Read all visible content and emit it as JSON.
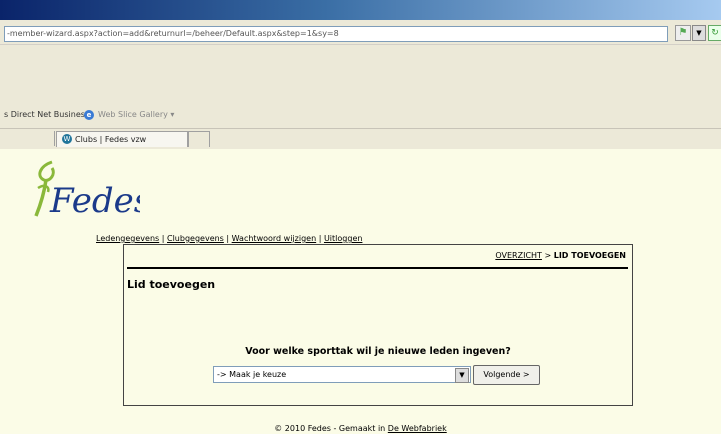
{
  "browser": {
    "address_url": "-member-wizard.aspx?action=add&returnurl=/beheer/Default.aspx&step=1&sy=8",
    "favorites": [
      {
        "label": "s Direct Net Business"
      },
      {
        "label": "Web Slice Gallery ▾"
      }
    ],
    "tabs": [
      {
        "label": "Clubs | Fedes vzw"
      }
    ]
  },
  "page": {
    "logo_text": "Fedes",
    "nav": {
      "ledengegevens": "Ledengegevens",
      "clubgegevens": "Clubgegevens",
      "wachtwoord": "Wachtwoord wijzigen",
      "uitloggen": "Uitloggen",
      "separator": "|"
    },
    "breadcrumb": {
      "overzicht": "OVERZICHT",
      "arrow": ">",
      "current": "LID TOEVOEGEN"
    },
    "title": "Lid toevoegen",
    "question": "Voor welke sporttak wil je nieuwe leden ingeven?",
    "select": {
      "selected": "-> Maak je keuze"
    },
    "next_button": "Volgende >",
    "footer": {
      "text": "© 2010 Fedes - Gemaakt in ",
      "link": "De Webfabriek"
    }
  },
  "colors": {
    "page_background": "#fbfce7",
    "logo_green": "#8ab83a",
    "logo_blue": "#1b3a8a"
  }
}
